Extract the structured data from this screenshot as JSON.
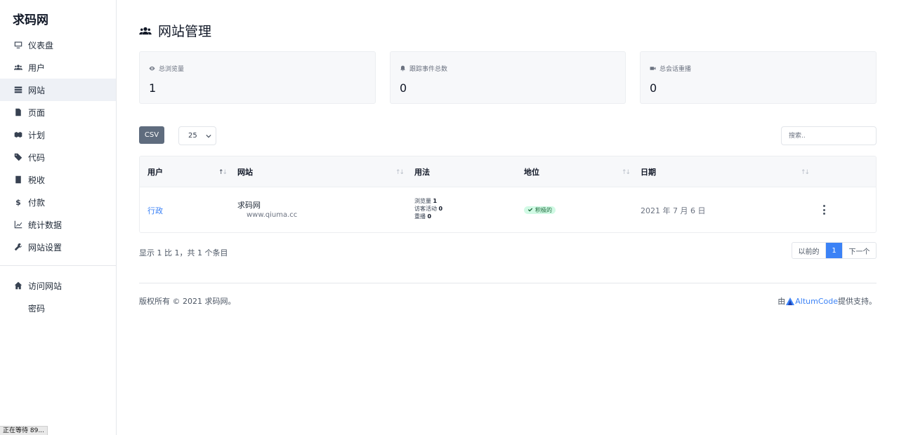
{
  "brand": "求码网",
  "sidebar": {
    "items": [
      {
        "label": "仪表盘",
        "icon": "monitor-icon"
      },
      {
        "label": "用户",
        "icon": "users-icon"
      },
      {
        "label": "网站",
        "icon": "server-icon",
        "active": true
      },
      {
        "label": "页面",
        "icon": "file-icon"
      },
      {
        "label": "计划",
        "icon": "box-icon"
      },
      {
        "label": "代码",
        "icon": "tags-icon"
      },
      {
        "label": "税收",
        "icon": "receipt-icon"
      },
      {
        "label": "付款",
        "icon": "dollar-icon"
      },
      {
        "label": "统计数据",
        "icon": "chart-line-icon"
      },
      {
        "label": "网站设置",
        "icon": "wrench-icon"
      }
    ],
    "bottom_items": [
      {
        "label": "访问网站",
        "icon": "home-icon"
      },
      {
        "label": "密码",
        "icon": ""
      }
    ]
  },
  "page": {
    "title": "网站管理",
    "title_icon": "users-icon"
  },
  "stats": [
    {
      "label": "总浏览量",
      "value": "1",
      "icon": "eye-icon"
    },
    {
      "label": "跟踪事件总数",
      "value": "0",
      "icon": "bell-icon"
    },
    {
      "label": "总会话重播",
      "value": "0",
      "icon": "video-icon"
    }
  ],
  "toolbar": {
    "csv_label": "CSV",
    "page_size": "25",
    "search_placeholder": "搜索.."
  },
  "table": {
    "headers": [
      "用户",
      "网站",
      "用法",
      "地位",
      "日期"
    ],
    "rows": [
      {
        "user": "行政",
        "site_name": "求码网",
        "site_host": "www.qiuma.cc",
        "usage": [
          {
            "label": "浏览量",
            "value": "1"
          },
          {
            "label": "访客活动",
            "value": "0"
          },
          {
            "label": "重播",
            "value": "0"
          }
        ],
        "status": "积极的",
        "date": "2021 年 7 月 6 日"
      }
    ]
  },
  "pagination": {
    "summary": "显示 1 比 1，共 1 个条目",
    "prev": "以前的",
    "current": "1",
    "next": "下一个"
  },
  "footer": {
    "copyright": "版权所有 © 2021 求码网。",
    "powered_prefix": "由",
    "powered_link": "AltumCode",
    "powered_suffix": "提供支持。"
  },
  "browser_status": "正在等待 89..."
}
